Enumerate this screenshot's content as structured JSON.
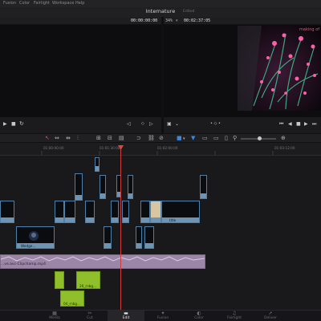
{
  "menu": [
    "Fusion",
    "Color",
    "Fairlight",
    "Workspace",
    "Help"
  ],
  "project": {
    "title": "Internature",
    "status": "Edited"
  },
  "viewer": {
    "source_timecode": "00:00:00:00",
    "zoom": "34%",
    "timeline_timecode": "00:02:37:05"
  },
  "program": {
    "overlay_text": "making of"
  },
  "ruler": {
    "ticks": [
      "01:00:00:00",
      "01:01:30:00",
      "01:02:00:00",
      "01:03:12:00"
    ]
  },
  "clips": {
    "video_names": [
      "Wedge...",
      "title"
    ],
    "audio_name": "...ve.avc-Clipchamp.mp4",
    "audio_small": [
      "20_rnbg...",
      "20_rnbg...",
      "04_rnbg..."
    ]
  },
  "pages": [
    {
      "label": "Media",
      "icon": "media-icon"
    },
    {
      "label": "Cut",
      "icon": "cut-icon"
    },
    {
      "label": "Edit",
      "icon": "edit-icon",
      "active": true
    },
    {
      "label": "Fusion",
      "icon": "fusion-icon"
    },
    {
      "label": "Color",
      "icon": "color-icon"
    },
    {
      "label": "Fairlight",
      "icon": "fairlight-icon"
    },
    {
      "label": "Deliver",
      "icon": "deliver-icon"
    }
  ],
  "colors": {
    "accent": "#d03a3a",
    "video_clip": "#6e93b3",
    "audio_clip": "#8fbf2a",
    "audio_track": "#9c86a8"
  }
}
